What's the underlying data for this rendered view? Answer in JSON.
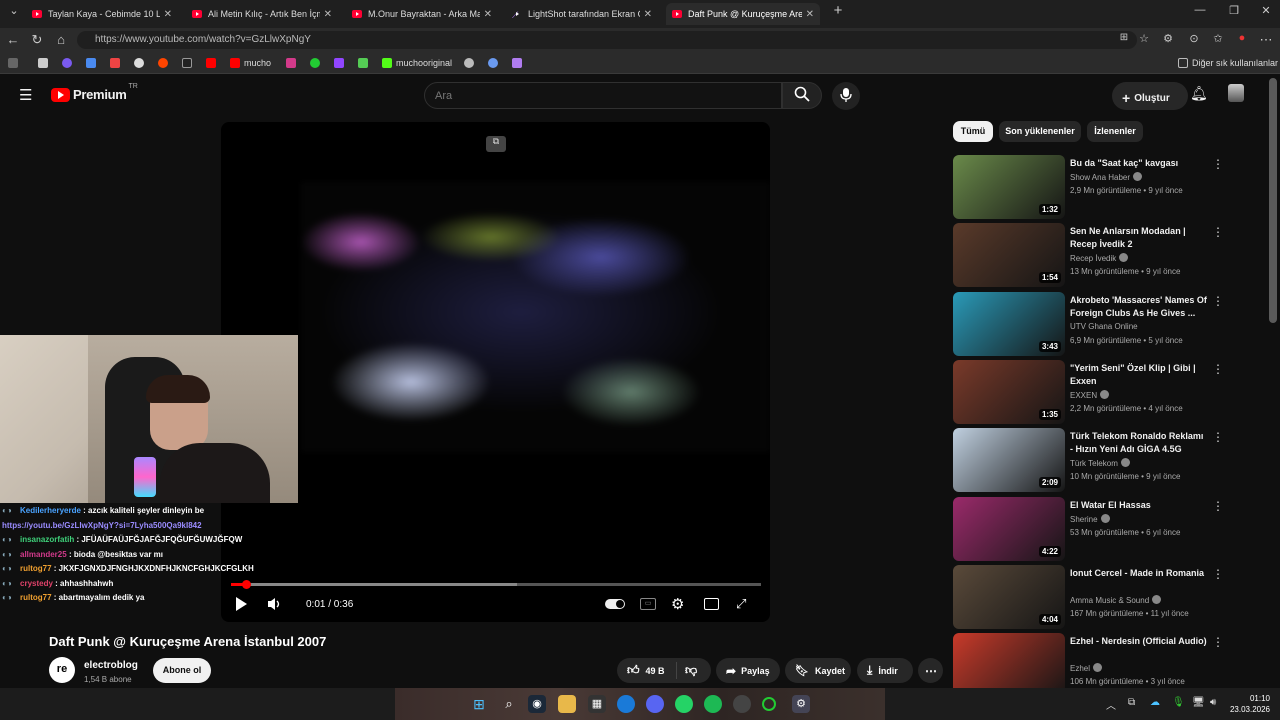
{
  "browser": {
    "tabs": [
      {
        "label": "Taylan Kaya - Cebimde 10 Liram V",
        "active": false
      },
      {
        "label": "Ali Metin Kılıç - Artık Ben İçmiyoru",
        "active": false
      },
      {
        "label": "M.Onur Bayraktan - Arka Mahalle",
        "active": false
      },
      {
        "label": "LightShot tarafından Ekran Görün",
        "active": false
      },
      {
        "label": "Daft Punk @ Kuruçeşme Arena İstanbul",
        "active": true
      }
    ],
    "url": "https://www.youtube.com/watch?v=GzLlwXpNgY",
    "bookmarks": [
      "mucho",
      "muchooriginal"
    ],
    "bookmarks_right": "Diğer sık kullanılanlar"
  },
  "youtube": {
    "logo": "Premium",
    "logo_region": "TR",
    "search_placeholder": "Ara",
    "create_label": "Oluştur"
  },
  "player": {
    "time": "0:01 / 0:36",
    "progress_fraction": 0.028,
    "buffered_fraction": 0.54
  },
  "video": {
    "title": "Daft Punk @ Kuruçeşme Arena İstanbul 2007",
    "channel": "electroblog",
    "channel_avatar": "re",
    "subscribers": "1,54 B abone",
    "subscribe_label": "Abone ol",
    "likes": "49 B",
    "share_label": "Paylaş",
    "save_label": "Kaydet",
    "download_label": "İndir"
  },
  "chat": [
    {
      "user": "Kedilerheryerde",
      "text": ": azcık kaliteli şeyler dinleyin be",
      "user_color": "#4aa3ff"
    },
    {
      "user": "",
      "text": "https://youtu.be/GzLlwXpNgY?si=7Lyha500Qa9kI842",
      "user_color": "#9a8cff"
    },
    {
      "user": "insanazorfatih",
      "text": ": JFÜAÜFAÜJFĞJAFĞJFQĞUFĞUWJĞFQW",
      "user_color": "#3fd17a"
    },
    {
      "user": "allmander25",
      "text": ": bioda @besiktas var mı",
      "user_color": "#d23a8b"
    },
    {
      "user": "rultog77",
      "text": ": JKXFJGNXDJFNGHJKXDNFHJKNCFGHJKCFGLKH",
      "user_color": "#f0a030"
    },
    {
      "user": "crystedy",
      "text": ": ahhashhahwh",
      "user_color": "#e0426a"
    },
    {
      "user": "rultog77",
      "text": ": abartmayalım dedik ya",
      "user_color": "#f0a030"
    }
  ],
  "sidebar": {
    "chips": [
      "Tümü",
      "Son yüklenenler",
      "İzlenenler"
    ],
    "recs": [
      {
        "title": "Bu da \"Saat kaç\" kavgası",
        "channel": "Show Ana Haber",
        "verified": true,
        "meta": "2,9 Mn görüntüleme • 9 yıl önce",
        "duration": "1:32",
        "thumb": "#6a8a4a"
      },
      {
        "title": "Sen Ne Anlarsın Modadan | Recep İvedik 2",
        "channel": "Recep İvedik",
        "verified": true,
        "meta": "13 Mn görüntüleme • 9 yıl önce",
        "duration": "1:54",
        "thumb": "#5a3a2a"
      },
      {
        "title": "Akrobeto 'Massacres' Names Of Foreign Clubs As He Gives ...",
        "channel": "UTV Ghana Online",
        "verified": false,
        "meta": "6,9 Mn görüntüleme • 5 yıl önce",
        "duration": "3:43",
        "thumb": "#2a9ab8"
      },
      {
        "title": "\"Yerim Seni\" Özel Klip | Gibi | Exxen",
        "channel": "EXXEN",
        "verified": true,
        "meta": "2,2 Mn görüntüleme • 4 yıl önce",
        "duration": "1:35",
        "thumb": "#7a3a2a"
      },
      {
        "title": "Türk Telekom Ronaldo Reklamı - Hızın Yeni Adı GİGA 4.5G",
        "channel": "Türk Telekom",
        "verified": true,
        "meta": "10 Mn görüntüleme • 9 yıl önce",
        "duration": "2:09",
        "thumb": "#c0d0e0"
      },
      {
        "title": "El Watar El Hassas",
        "channel": "Sherine",
        "verified": true,
        "meta": "53 Mn görüntüleme • 6 yıl önce",
        "duration": "4:22",
        "thumb": "#9a2a6a"
      },
      {
        "title": "Ionut Cercel - Made in Romania",
        "channel": "Amma Music & Sound",
        "verified": true,
        "meta": "167 Mn görüntüleme • 11 yıl önce",
        "duration": "4:04",
        "thumb": "#5a4a3a"
      },
      {
        "title": "Ezhel - Nerdesin (Official Audio)",
        "channel": "Ezhel",
        "verified": true,
        "meta": "106 Mn görüntüleme • 3 yıl önce",
        "duration": "",
        "thumb": "#c83a2a"
      }
    ]
  },
  "taskbar": {
    "time": "01:10",
    "date": "23.03.2026"
  }
}
